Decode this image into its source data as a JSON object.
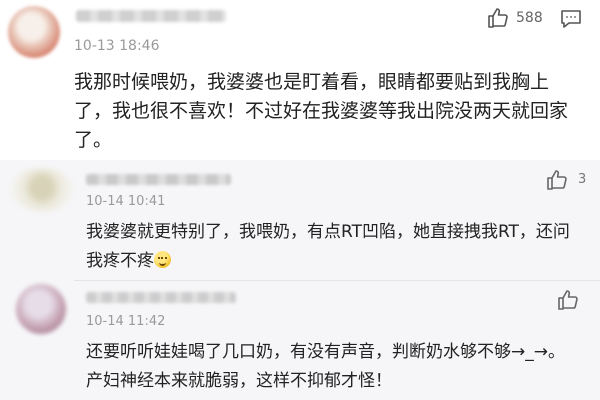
{
  "main_comment": {
    "time": "10-13 18:46",
    "like_count": "588",
    "text": "我那时候喂奶，我婆婆也是盯着看，眼睛都要贴到我胸上了，我也很不喜欢！不过好在我婆婆等我出院没两天就回家了。",
    "icons": [
      "thumbs-up-icon",
      "reply-icon"
    ]
  },
  "replies": [
    {
      "time": "10-14 10:41",
      "like_count": "3",
      "text": "我婆婆就更特别了，我喂奶，有点RT凹陷，她直接拽我RT，还问我疼不疼",
      "emoji": "smile-emoji"
    },
    {
      "time": "10-14 11:42",
      "like_count": "",
      "text_line1": "还要听听娃娃喝了几口奶，有没有声音，判断奶水够不够→_→。",
      "text_line2": "产妇神经本来就脆弱，这样不抑郁才怪！"
    }
  ],
  "colors": {
    "reply_background": "#f6f6f8",
    "meta_text": "#9a9a9a",
    "body_text": "#222222"
  }
}
